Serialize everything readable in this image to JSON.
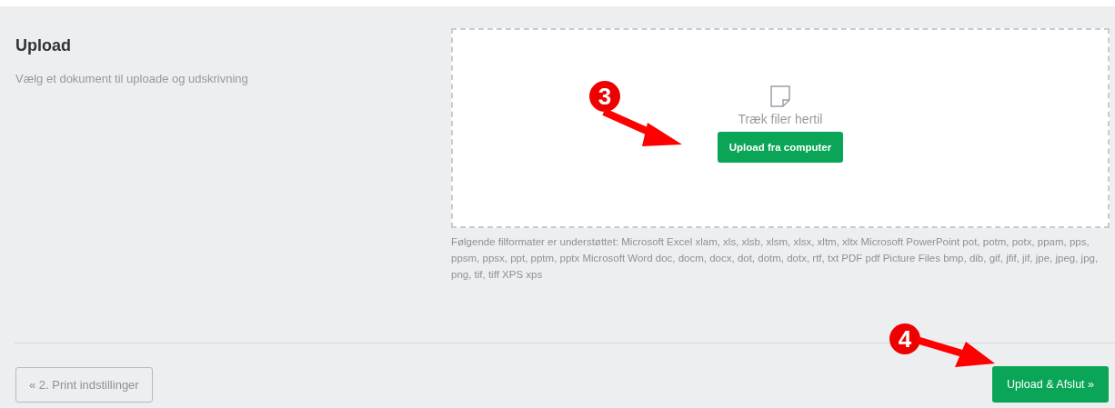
{
  "section": {
    "title": "Upload",
    "description": "Vælg et dokument til uploade og udskrivning"
  },
  "dropzone": {
    "hint": "Træk filer hertil",
    "button": "Upload fra computer"
  },
  "supported_formats": "Følgende filformater er understøttet: Microsoft Excel xlam, xls, xlsb, xlsm, xlsx, xltm, xltx Microsoft PowerPoint pot, potm, potx, ppam, pps, ppsm, ppsx, ppt, pptm, pptx Microsoft Word doc, docm, docx, dot, dotm, dotx, rtf, txt PDF pdf Picture Files bmp, dib, gif, jfif, jif, jpe, jpeg, jpg, png, tif, tiff XPS xps",
  "footer": {
    "back_button": "« 2. Print indstillinger",
    "finish_button": "Upload & Afslut »"
  },
  "annotations": [
    {
      "label": "3"
    },
    {
      "label": "4"
    }
  ]
}
